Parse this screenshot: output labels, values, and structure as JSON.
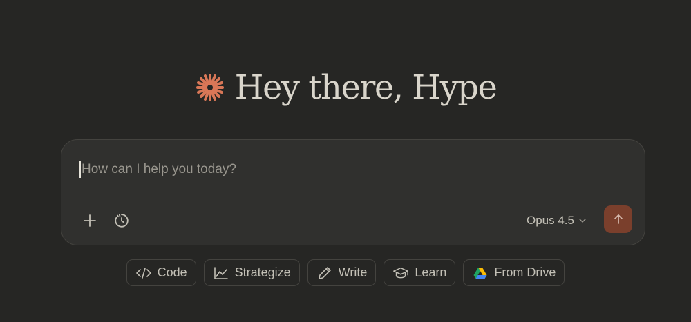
{
  "greeting": {
    "text": "Hey there, Hype",
    "logo_icon": "claude-starburst-icon",
    "logo_color": "#d97757"
  },
  "composer": {
    "placeholder": "How can I help you today?",
    "tools": [
      {
        "name": "add-icon"
      },
      {
        "name": "history-icon"
      }
    ],
    "model": {
      "label": "Opus 4.5",
      "icon": "chevron-down-icon"
    },
    "send": {
      "icon": "arrow-up-icon",
      "color": "#7a3f2c"
    }
  },
  "chips": [
    {
      "label": "Code",
      "icon": "code-icon"
    },
    {
      "label": "Strategize",
      "icon": "line-chart-icon"
    },
    {
      "label": "Write",
      "icon": "pencil-icon"
    },
    {
      "label": "Learn",
      "icon": "graduation-cap-icon"
    },
    {
      "label": "From Drive",
      "icon": "google-drive-icon"
    }
  ]
}
